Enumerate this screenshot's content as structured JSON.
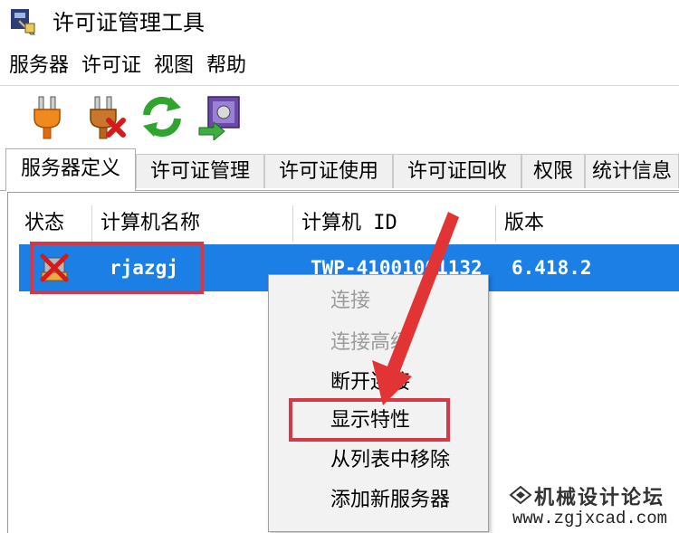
{
  "window": {
    "title": "许可证管理工具",
    "icon": "license-tool-icon"
  },
  "menu": [
    "服务器",
    "许可证",
    "视图",
    "帮助"
  ],
  "toolbar": {
    "buttons": [
      {
        "icon": "plug-connect-icon"
      },
      {
        "icon": "plug-disconnect-icon"
      },
      {
        "icon": "refresh-icon"
      },
      {
        "icon": "export-icon"
      }
    ]
  },
  "tabs": [
    "服务器定义",
    "许可证管理",
    "许可证使用",
    "许可证回收",
    "权限",
    "统计信息"
  ],
  "table": {
    "columns": [
      "状态",
      "计算机名称",
      "计算机 ID",
      "版本"
    ],
    "rows": [
      {
        "status_icon": "disconnected-status-icon",
        "name": "rjazgj",
        "id": "TWP-41001001132",
        "version": "6.418.2"
      }
    ]
  },
  "context_menu": {
    "items": [
      {
        "label": "连接",
        "enabled": false
      },
      {
        "label": "连接高级",
        "enabled": false
      },
      {
        "label": "断开连接",
        "enabled": true
      },
      {
        "label": "显示特性",
        "enabled": true,
        "highlighted": true
      },
      {
        "label": "从列表中移除",
        "enabled": true
      },
      {
        "label": "添加新服务器",
        "enabled": true
      }
    ]
  },
  "watermark": {
    "title": "机械设计论坛",
    "url": "www.zgjxcad.com"
  },
  "colors": {
    "selection": "#1c7fe6",
    "annotation": "#d23a4a"
  }
}
